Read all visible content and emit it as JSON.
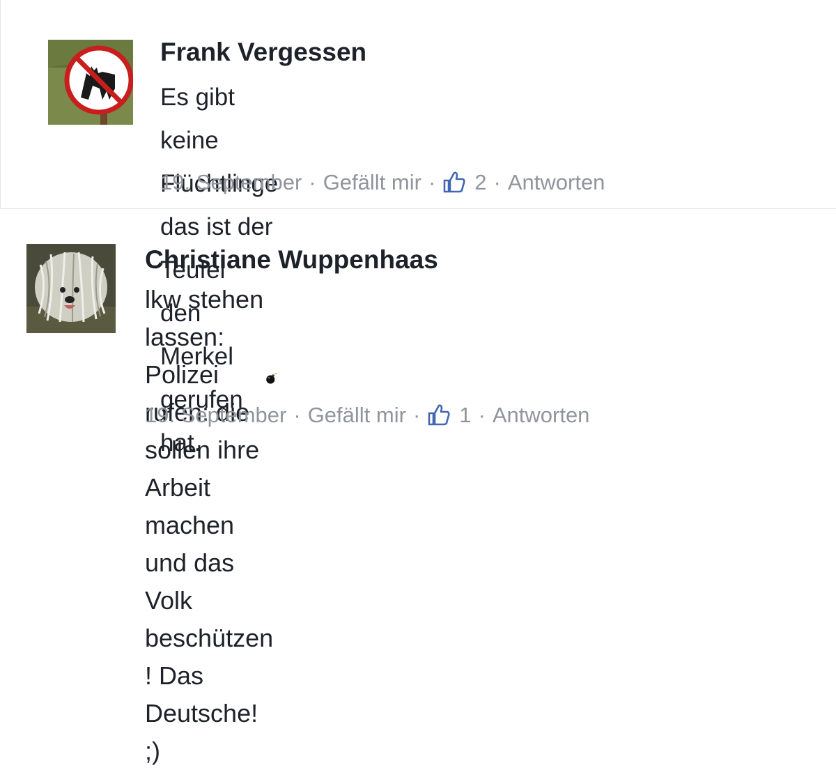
{
  "comments": [
    {
      "author": "Frank Vergessen",
      "text_lines": [
        "Es gibt keine Flüchtlinge das ist der Teufel",
        "den Merkel gerufen hat."
      ],
      "emoji": "bomb",
      "date": "19. September",
      "like_label": "Gefällt mir",
      "like_count": "2",
      "reply_label": "Antworten",
      "sep": "·"
    },
    {
      "author": "Christiane Wuppenhaas",
      "text_lines": [
        "lkw stehen lassen: Polizei rufen: die sollen ihre",
        "Arbeit machen und das Volk beschützen ! Das",
        "Deutsche! ;)"
      ],
      "date": "19. September",
      "like_label": "Gefällt mir",
      "like_count": "1",
      "reply_label": "Antworten",
      "sep": "·"
    }
  ],
  "icons": {
    "like": "thumbs-up-icon",
    "emoji": "bomb-icon"
  },
  "colors": {
    "name": "#1d2129",
    "meta": "#90949c",
    "thumb": "#4267b2"
  }
}
